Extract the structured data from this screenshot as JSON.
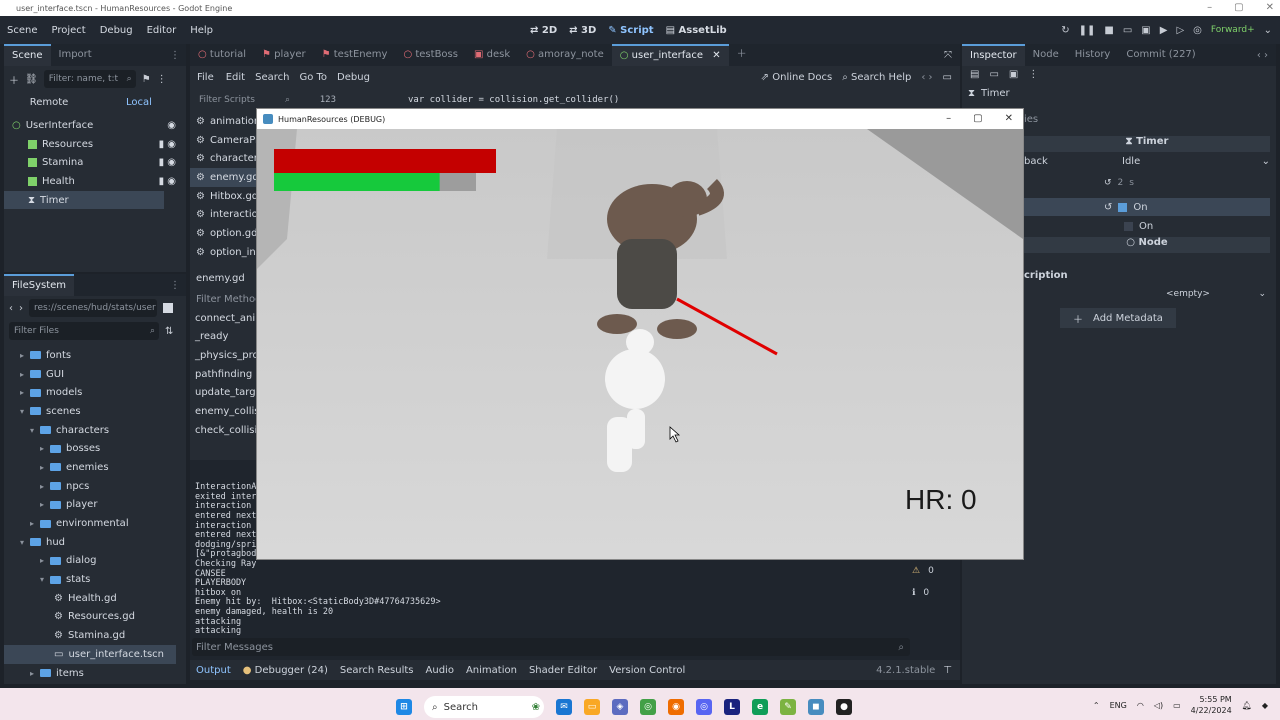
{
  "window": {
    "title": "user_interface.tscn - HumanResources - Godot Engine",
    "controls": [
      "–",
      "▢",
      "✕"
    ]
  },
  "menubar": {
    "items": [
      "Scene",
      "Project",
      "Debug",
      "Editor",
      "Help"
    ],
    "workspaces": [
      "2D",
      "3D",
      "Script",
      "AssetLib"
    ],
    "renderer": "Forward+"
  },
  "scene_dock": {
    "tabs": [
      "Scene",
      "Import"
    ],
    "filter_placeholder": "Filter: name, t:t",
    "remote": "Remote",
    "local": "Local",
    "nodes": [
      "UserInterface",
      "Resources",
      "Stamina",
      "Health",
      "Timer"
    ]
  },
  "filesystem": {
    "tab": "FileSystem",
    "path": "res://scenes/hud/stats/user",
    "filter_placeholder": "Filter Files",
    "items": [
      "fonts",
      "GUI",
      "models",
      "scenes",
      "characters",
      "bosses",
      "enemies",
      "npcs",
      "player",
      "environmental",
      "hud",
      "dialog",
      "stats",
      "Health.gd",
      "Resources.gd",
      "Stamina.gd",
      "user_interface.tscn",
      "items"
    ]
  },
  "editor_tabs": [
    "tutorial",
    "player",
    "testEnemy",
    "testBoss",
    "desk",
    "amoray_note",
    "user_interface"
  ],
  "script_menu": [
    "File",
    "Edit",
    "Search",
    "Go To",
    "Debug"
  ],
  "script_help": {
    "online_docs": "Online Docs",
    "search_help": "Search Help"
  },
  "script_list": {
    "filter_placeholder": "Filter Scripts",
    "items": [
      "animation",
      "CameraPiv",
      "characterP",
      "enemy.gd",
      "Hitbox.gd",
      "interaction",
      "option.gd",
      "option_ind"
    ],
    "current": "enemy.gd",
    "methods_placeholder": "Filter Methods",
    "methods": [
      "connect_anim",
      "_ready",
      "_physics_proc",
      "pathfinding",
      "update_target",
      "enemy_collisi",
      "check_collisio"
    ]
  },
  "code": {
    "line_no": "123",
    "text": "var collider = collision.get_collider()"
  },
  "console": {
    "lines": [
      "InteractionA",
      "exited inter",
      "interaction",
      "entered next",
      "interaction",
      "entered next",
      "dodging/spri",
      "[&\"protagbod",
      "Checking Ray",
      "CANSEE",
      "PLAYERBODY",
      "hitbox on",
      "Enemy hit by:  Hitbox:<StaticBody3D#47764735629>",
      "enemy damaged, health is 20",
      "attacking",
      "attacking"
    ],
    "filter_placeholder": "Filter Messages",
    "warnings": "0",
    "errors": "0"
  },
  "bottom_tabs": [
    "Output",
    "Debugger (24)",
    "Search Results",
    "Audio",
    "Animation",
    "Shader Editor",
    "Version Control"
  ],
  "version": "4.2.1.stable",
  "inspector": {
    "tabs": [
      "Inspector",
      "Node",
      "History",
      "Commit (227)"
    ],
    "node": "Timer",
    "filter_placeholder": "ies",
    "section": "Timer",
    "callback_label": "back",
    "callback_value": "Idle",
    "wait_time": "2",
    "one_shot": "On",
    "autostart": "On",
    "node_section": "Node",
    "description": "cription",
    "metadata_value": "<empty>",
    "add_metadata": "Add Metadata"
  },
  "game": {
    "title": "HumanResources (DEBUG)",
    "hr_text": "HR: 0",
    "health_fraction": 1.0,
    "stamina_fraction": 0.82,
    "health_color": "#c40000",
    "stamina_color": "#16c93c"
  },
  "taskbar": {
    "search": "Search",
    "lang": "ENG",
    "time": "5:55 PM",
    "date": "4/22/2024"
  }
}
